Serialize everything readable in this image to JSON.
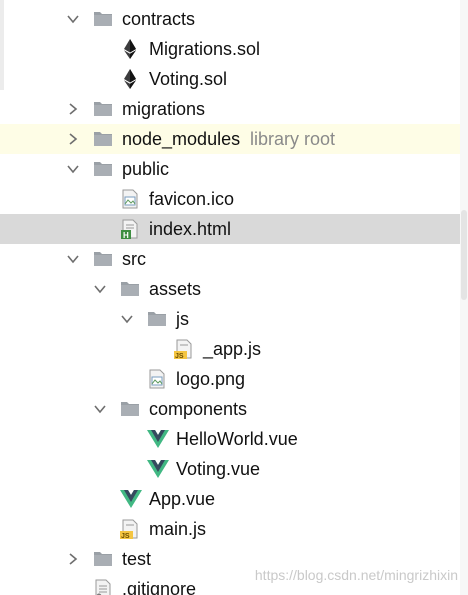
{
  "project_tree": {
    "rows": [
      {
        "label": "contracts",
        "hint": "",
        "icon": "folder-icon",
        "expanded": true,
        "has_children": true,
        "level": 0
      },
      {
        "label": "Migrations.sol",
        "hint": "",
        "icon": "ethereum-icon",
        "level": 1
      },
      {
        "label": "Voting.sol",
        "hint": "",
        "icon": "ethereum-icon",
        "level": 1
      },
      {
        "label": "migrations",
        "hint": "",
        "icon": "folder-icon",
        "expanded": false,
        "has_children": true,
        "level": 0
      },
      {
        "label": "node_modules",
        "hint": "library root",
        "icon": "folder-icon",
        "expanded": false,
        "has_children": true,
        "level": 0
      },
      {
        "label": "public",
        "hint": "",
        "icon": "folder-icon",
        "expanded": true,
        "has_children": true,
        "level": 0
      },
      {
        "label": "favicon.ico",
        "hint": "",
        "icon": "image-file-icon",
        "level": 1
      },
      {
        "label": "index.html",
        "hint": "",
        "icon": "html-file-icon",
        "level": 1,
        "selected": true
      },
      {
        "label": "src",
        "hint": "",
        "icon": "folder-icon",
        "expanded": true,
        "has_children": true,
        "level": 0
      },
      {
        "label": "assets",
        "hint": "",
        "icon": "folder-icon",
        "expanded": true,
        "has_children": true,
        "level": 1
      },
      {
        "label": "js",
        "hint": "",
        "icon": "folder-icon",
        "expanded": true,
        "has_children": true,
        "level": 2
      },
      {
        "label": "_app.js",
        "hint": "",
        "icon": "js-file-icon",
        "level": 3
      },
      {
        "label": "logo.png",
        "hint": "",
        "icon": "image-file-icon",
        "level": 2
      },
      {
        "label": "components",
        "hint": "",
        "icon": "folder-icon",
        "expanded": true,
        "has_children": true,
        "level": 1
      },
      {
        "label": "HelloWorld.vue",
        "hint": "",
        "icon": "vue-icon",
        "level": 2
      },
      {
        "label": "Voting.vue",
        "hint": "",
        "icon": "vue-icon",
        "level": 2
      },
      {
        "label": "App.vue",
        "hint": "",
        "icon": "vue-icon",
        "level": 1
      },
      {
        "label": "main.js",
        "hint": "",
        "icon": "js-file-icon",
        "level": 1
      },
      {
        "label": "test",
        "hint": "",
        "icon": "folder-icon",
        "expanded": false,
        "has_children": true,
        "level": 0
      },
      {
        "label": ".gitignore",
        "hint": "",
        "icon": "text-file-icon",
        "level": 0
      }
    ]
  },
  "watermark": "https://blog.csdn.net/mingrizhixin",
  "colors": {
    "folder": "#9aa0a6",
    "chevron": "#6e6e6e",
    "vue_green": "#41b883",
    "vue_dark": "#35495e",
    "selected_row": "#d9d9d9",
    "library_row": "#fefde6",
    "hint_text": "#8a8a8a",
    "js_badge": "#f4c542"
  }
}
